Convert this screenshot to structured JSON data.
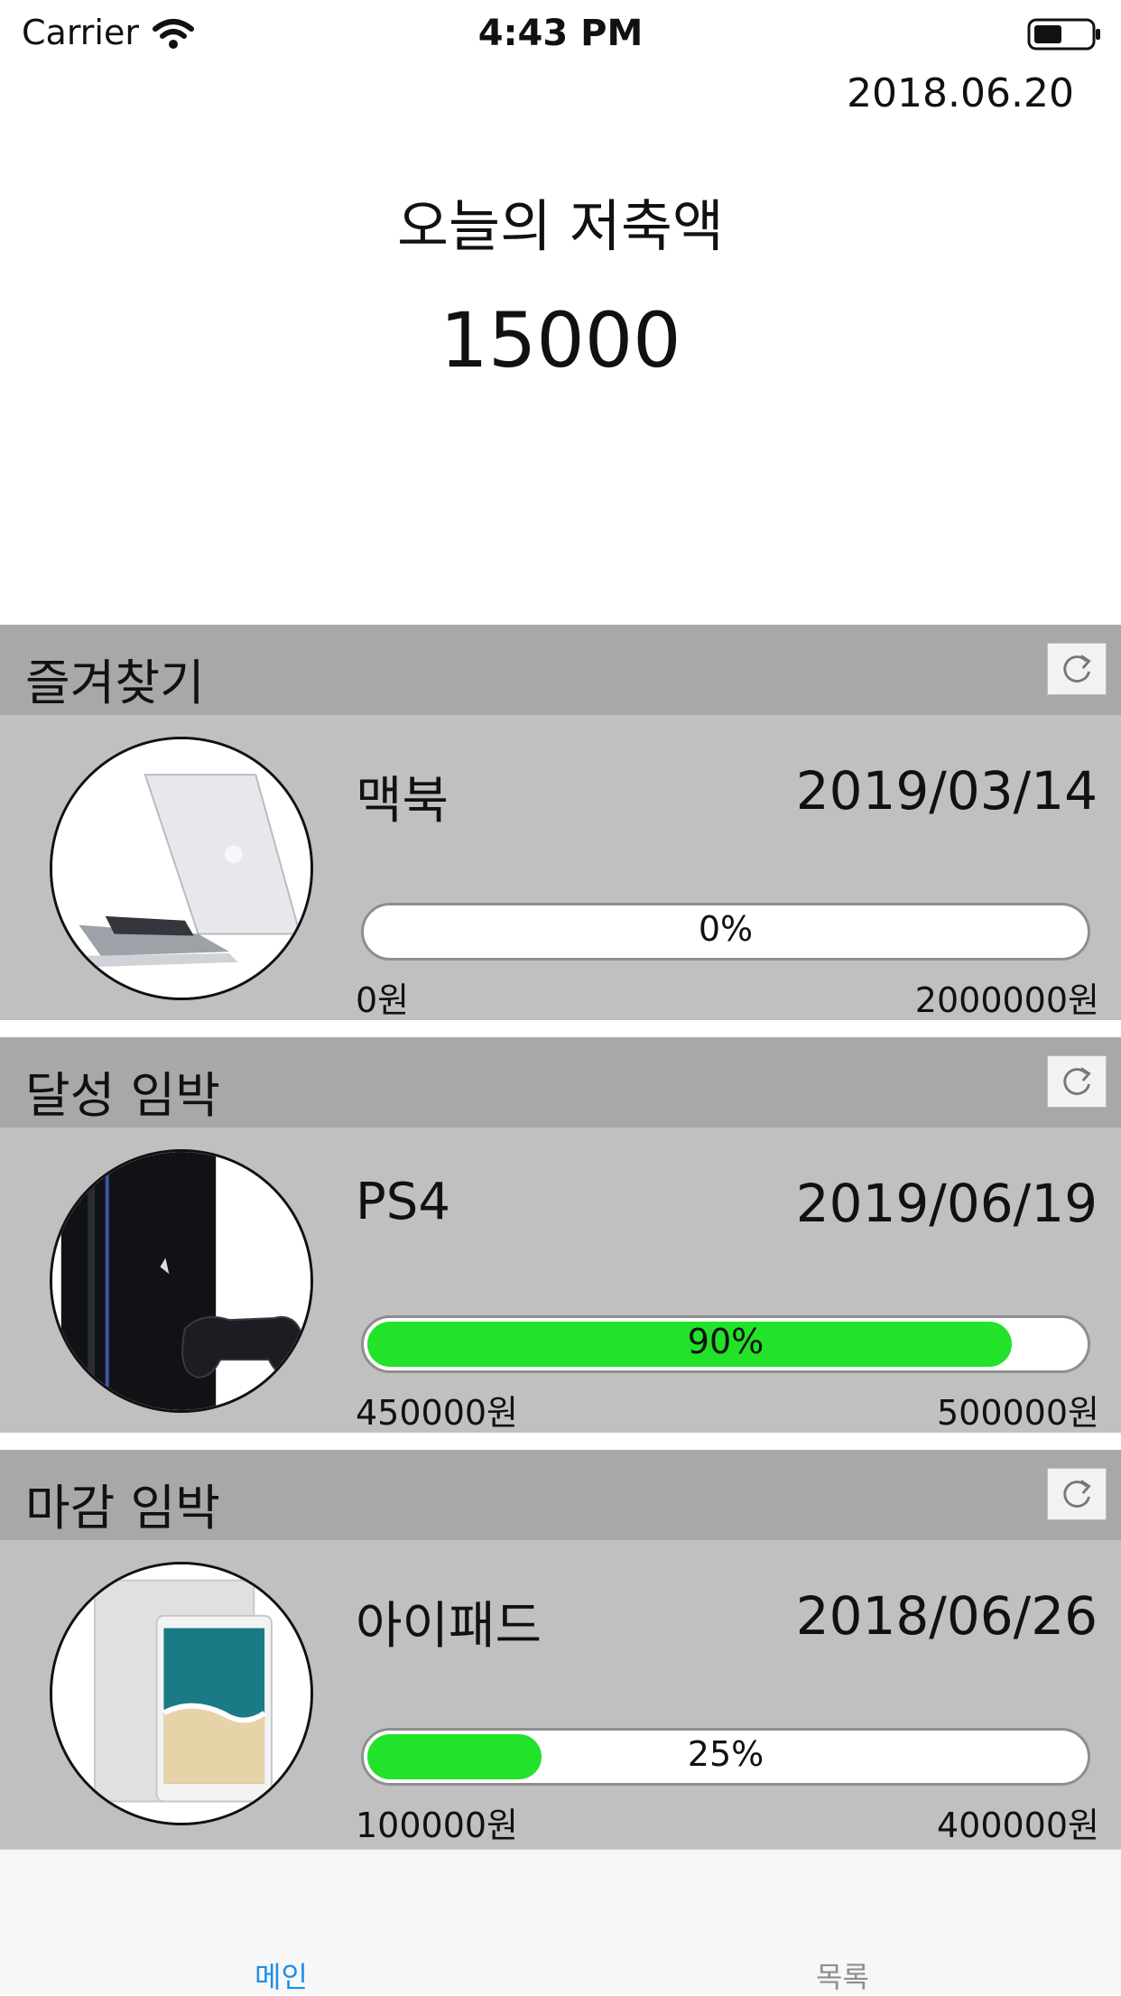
{
  "status_bar": {
    "carrier": "Carrier",
    "time": "4:43 PM"
  },
  "header": {
    "date": "2018.06.20",
    "title": "오늘의 저축액",
    "amount": "15000"
  },
  "sections": [
    {
      "label": "즐겨찾기",
      "item": {
        "name": "맥북",
        "due": "2019/03/14",
        "progress": 0,
        "progress_label": "0%",
        "min_label": "0원",
        "max_label": "2000000원",
        "image": "macbook-image"
      }
    },
    {
      "label": "달성 임박",
      "item": {
        "name": "PS4",
        "due": "2019/06/19",
        "progress": 0.9,
        "progress_label": "90%",
        "min_label": "450000원",
        "max_label": "500000원",
        "image": "ps4-image"
      }
    },
    {
      "label": "마감 임박",
      "item": {
        "name": "아이패드",
        "due": "2018/06/26",
        "progress": 0.25,
        "progress_label": "25%",
        "min_label": "100000원",
        "max_label": "400000원",
        "image": "ipad-image"
      }
    }
  ],
  "tabs": [
    {
      "label": "메인",
      "selected": true
    },
    {
      "label": "목록",
      "selected": false
    }
  ],
  "colors": {
    "progress_fill": "#22e22a",
    "tab_active": "#1e8fe8",
    "section_header": "#a8a8a8",
    "card_bg": "#c0c0c0"
  }
}
